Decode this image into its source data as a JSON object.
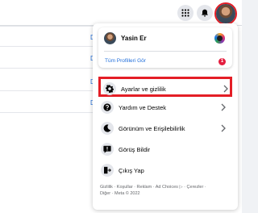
{
  "profile": {
    "name": "Yasin Er",
    "link": "Tüm Profilleri Gör",
    "badge": "1"
  },
  "menu_items": [
    {
      "label": "Ayarlar ve gizlilik",
      "icon": "gear-icon",
      "has_chevron": true,
      "highlighted": true
    },
    {
      "label": "Yardım ve Destek",
      "icon": "question-icon",
      "has_chevron": true
    },
    {
      "label": "Görünüm ve Erişilebilirlik",
      "icon": "moon-icon",
      "has_chevron": true
    },
    {
      "label": "Görüş Bildir",
      "icon": "feedback-icon",
      "has_chevron": false
    },
    {
      "label": "Çıkış Yap",
      "icon": "logout-icon",
      "has_chevron": false
    }
  ],
  "footer": {
    "line1": "Gizlilik · Koşullar · Reklam · Ad Choices ▷ · Çerezler ·",
    "line2": "Diğer · Meta © 2022"
  },
  "background": {
    "link_letter": "D"
  },
  "colors": {
    "highlight": "#e41e26",
    "link": "#216fdb",
    "badge": "#e41e3f"
  }
}
